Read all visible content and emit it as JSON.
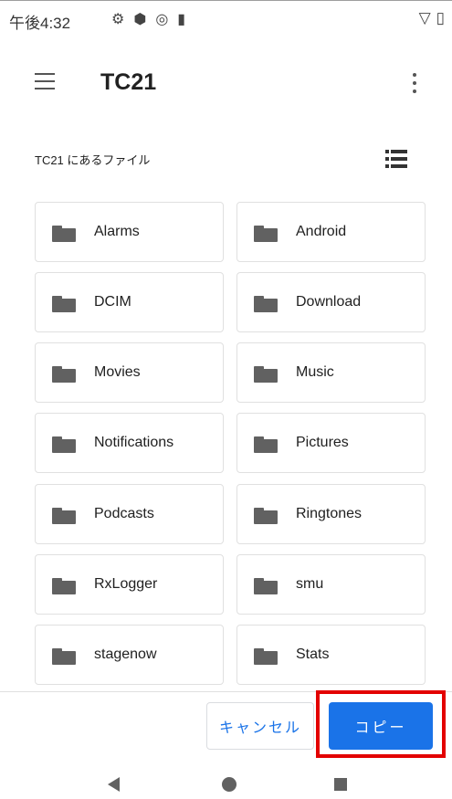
{
  "status_bar": {
    "time": "午後4:32",
    "icons": [
      "settings-icon",
      "shield-icon",
      "at-sign-icon",
      "sd-card-icon"
    ],
    "right_icons": [
      "wifi-icon",
      "battery-icon"
    ]
  },
  "app_bar": {
    "title": "TC21"
  },
  "section": {
    "header": "TC21 にあるファイル"
  },
  "folders": [
    {
      "name": "Alarms"
    },
    {
      "name": "Android"
    },
    {
      "name": "DCIM"
    },
    {
      "name": "Download"
    },
    {
      "name": "Movies"
    },
    {
      "name": "Music"
    },
    {
      "name": "Notifications"
    },
    {
      "name": "Pictures"
    },
    {
      "name": "Podcasts"
    },
    {
      "name": "Ringtones"
    },
    {
      "name": "RxLogger"
    },
    {
      "name": "smu"
    },
    {
      "name": "stagenow"
    },
    {
      "name": "Stats"
    }
  ],
  "actions": {
    "cancel_label": "キャンセル",
    "copy_label": "コピー"
  },
  "colors": {
    "accent": "#1a73e8",
    "highlight": "#e30000",
    "folder_icon": "#616161"
  }
}
